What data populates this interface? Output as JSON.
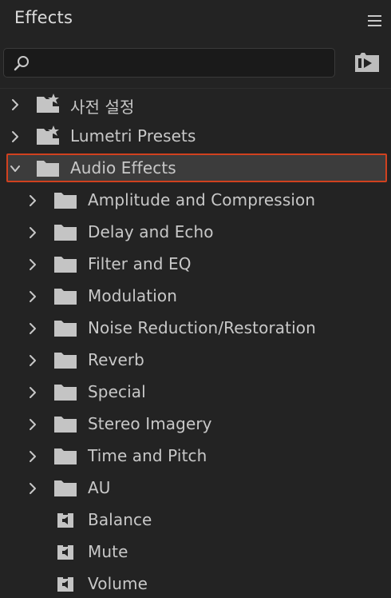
{
  "header": {
    "title": "Effects",
    "menu_icon": "hamburger-menu-icon"
  },
  "search": {
    "value": "",
    "placeholder": "",
    "icon": "search-icon",
    "new_bin_icon": "new-custom-bin-icon"
  },
  "colors": {
    "panel_bg": "#232323",
    "selection_bg": "#3c3c3c",
    "selection_border": "#d0411f",
    "text": "#c8c8c8",
    "icon": "#c4c4c4"
  },
  "tree": {
    "items": [
      {
        "label": "사전 설정",
        "icon": "preset-folder-icon",
        "expandable": true,
        "expanded": false,
        "depth": 0,
        "selected": false
      },
      {
        "label": "Lumetri Presets",
        "icon": "preset-folder-icon",
        "expandable": true,
        "expanded": false,
        "depth": 0,
        "selected": false
      },
      {
        "label": "Audio Effects",
        "icon": "folder-icon",
        "expandable": true,
        "expanded": true,
        "depth": 0,
        "selected": true
      },
      {
        "label": "Amplitude and Compression",
        "icon": "folder-icon",
        "expandable": true,
        "expanded": false,
        "depth": 1,
        "selected": false
      },
      {
        "label": "Delay and Echo",
        "icon": "folder-icon",
        "expandable": true,
        "expanded": false,
        "depth": 1,
        "selected": false
      },
      {
        "label": "Filter and EQ",
        "icon": "folder-icon",
        "expandable": true,
        "expanded": false,
        "depth": 1,
        "selected": false
      },
      {
        "label": "Modulation",
        "icon": "folder-icon",
        "expandable": true,
        "expanded": false,
        "depth": 1,
        "selected": false
      },
      {
        "label": "Noise Reduction/Restoration",
        "icon": "folder-icon",
        "expandable": true,
        "expanded": false,
        "depth": 1,
        "selected": false
      },
      {
        "label": "Reverb",
        "icon": "folder-icon",
        "expandable": true,
        "expanded": false,
        "depth": 1,
        "selected": false
      },
      {
        "label": "Special",
        "icon": "folder-icon",
        "expandable": true,
        "expanded": false,
        "depth": 1,
        "selected": false
      },
      {
        "label": "Stereo Imagery",
        "icon": "folder-icon",
        "expandable": true,
        "expanded": false,
        "depth": 1,
        "selected": false
      },
      {
        "label": "Time and Pitch",
        "icon": "folder-icon",
        "expandable": true,
        "expanded": false,
        "depth": 1,
        "selected": false
      },
      {
        "label": "AU",
        "icon": "folder-icon",
        "expandable": true,
        "expanded": false,
        "depth": 1,
        "selected": false
      },
      {
        "label": "Balance",
        "icon": "audio-effect-icon",
        "expandable": false,
        "expanded": false,
        "depth": 1,
        "selected": false
      },
      {
        "label": "Mute",
        "icon": "audio-effect-icon",
        "expandable": false,
        "expanded": false,
        "depth": 1,
        "selected": false
      },
      {
        "label": "Volume",
        "icon": "audio-effect-icon",
        "expandable": false,
        "expanded": false,
        "depth": 1,
        "selected": false
      }
    ]
  }
}
